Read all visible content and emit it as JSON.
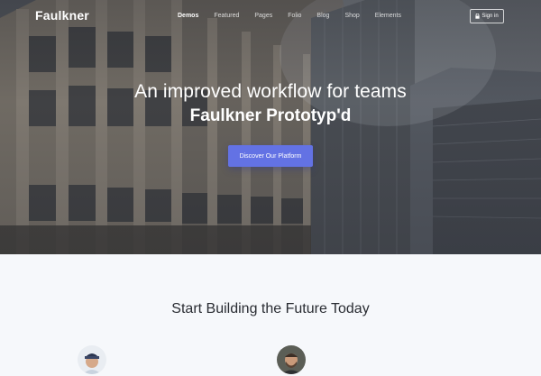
{
  "nav": {
    "logo": "Faulkner",
    "menu": [
      "Demos",
      "Featured",
      "Pages",
      "Folio",
      "Blog",
      "Shop",
      "Elements"
    ],
    "active_index": 0,
    "signin_label": "Sign in"
  },
  "hero": {
    "headline": "An improved workflow for teams",
    "subheadline": "Faulkner Prototyp'd",
    "cta_label": "Discover Our Platform"
  },
  "section": {
    "title": "Start Building the Future Today"
  },
  "colors": {
    "accent": "#6372e4",
    "lower_bg": "#f6f8fb"
  },
  "icons": {
    "signin": "lock-icon"
  }
}
